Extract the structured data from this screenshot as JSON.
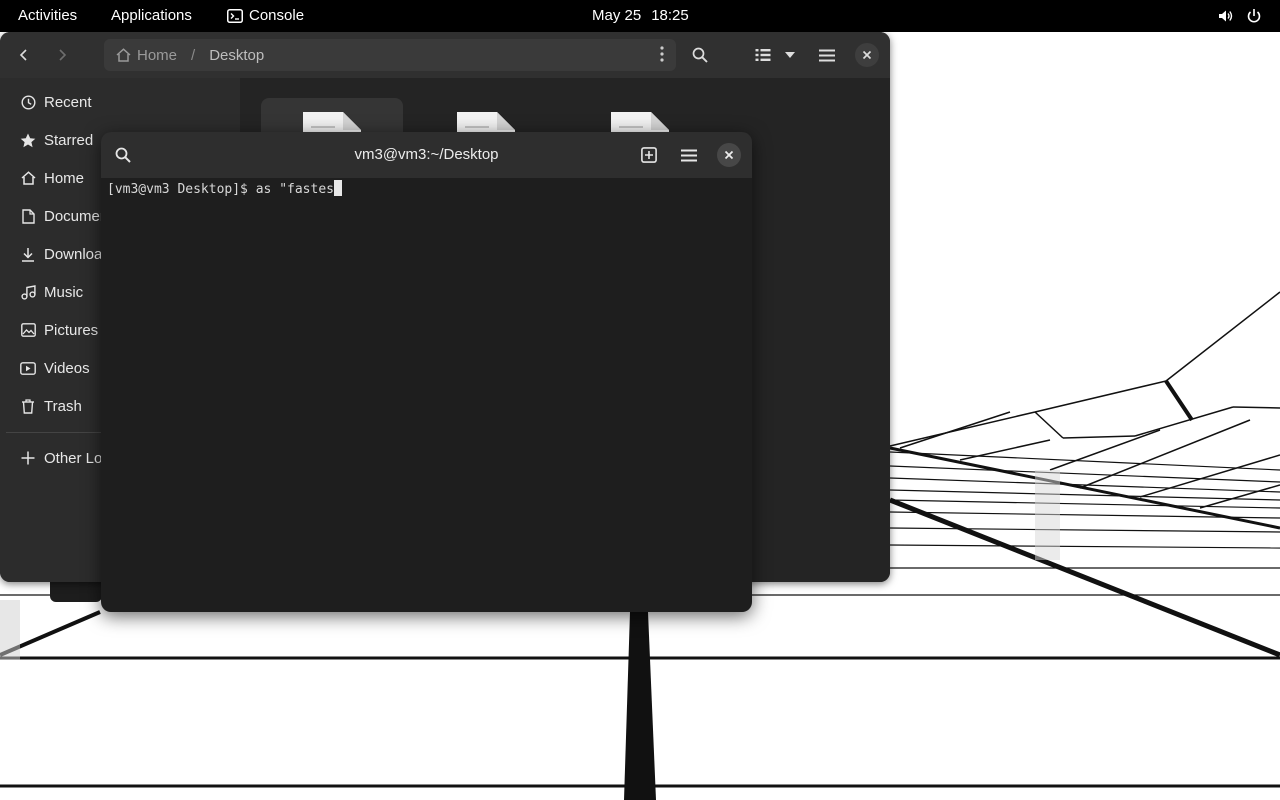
{
  "topbar": {
    "activities": "Activities",
    "applications": "Applications",
    "console": "Console",
    "date": "May 25",
    "time": "18:25",
    "icons": [
      "volume-icon",
      "power-icon"
    ]
  },
  "files": {
    "path_home": "Home",
    "path_separator": "/",
    "path_current": "Desktop",
    "sidebar": {
      "items": [
        {
          "label": "Recent",
          "icon": "clock-icon"
        },
        {
          "label": "Starred",
          "icon": "star-icon"
        },
        {
          "label": "Home",
          "icon": "home-icon"
        },
        {
          "label": "Documents",
          "icon": "document-icon"
        },
        {
          "label": "Downloads",
          "icon": "download-icon"
        },
        {
          "label": "Music",
          "icon": "music-icon"
        },
        {
          "label": "Pictures",
          "icon": "picture-icon"
        },
        {
          "label": "Videos",
          "icon": "video-icon"
        },
        {
          "label": "Trash",
          "icon": "trash-icon"
        },
        {
          "label": "Other Locations",
          "icon": "plus-icon"
        }
      ]
    }
  },
  "terminal": {
    "title": "vm3@vm3:~/Desktop",
    "prompt": "[vm3@vm3 Desktop]$ ",
    "input": "as \"fastes"
  },
  "colors": {
    "topbar_bg": "#000000",
    "window_bg": "#242424",
    "header_bg": "#303030",
    "sidebar_bg": "#2c2c2c",
    "terminal_bg": "#1e1e1e"
  }
}
